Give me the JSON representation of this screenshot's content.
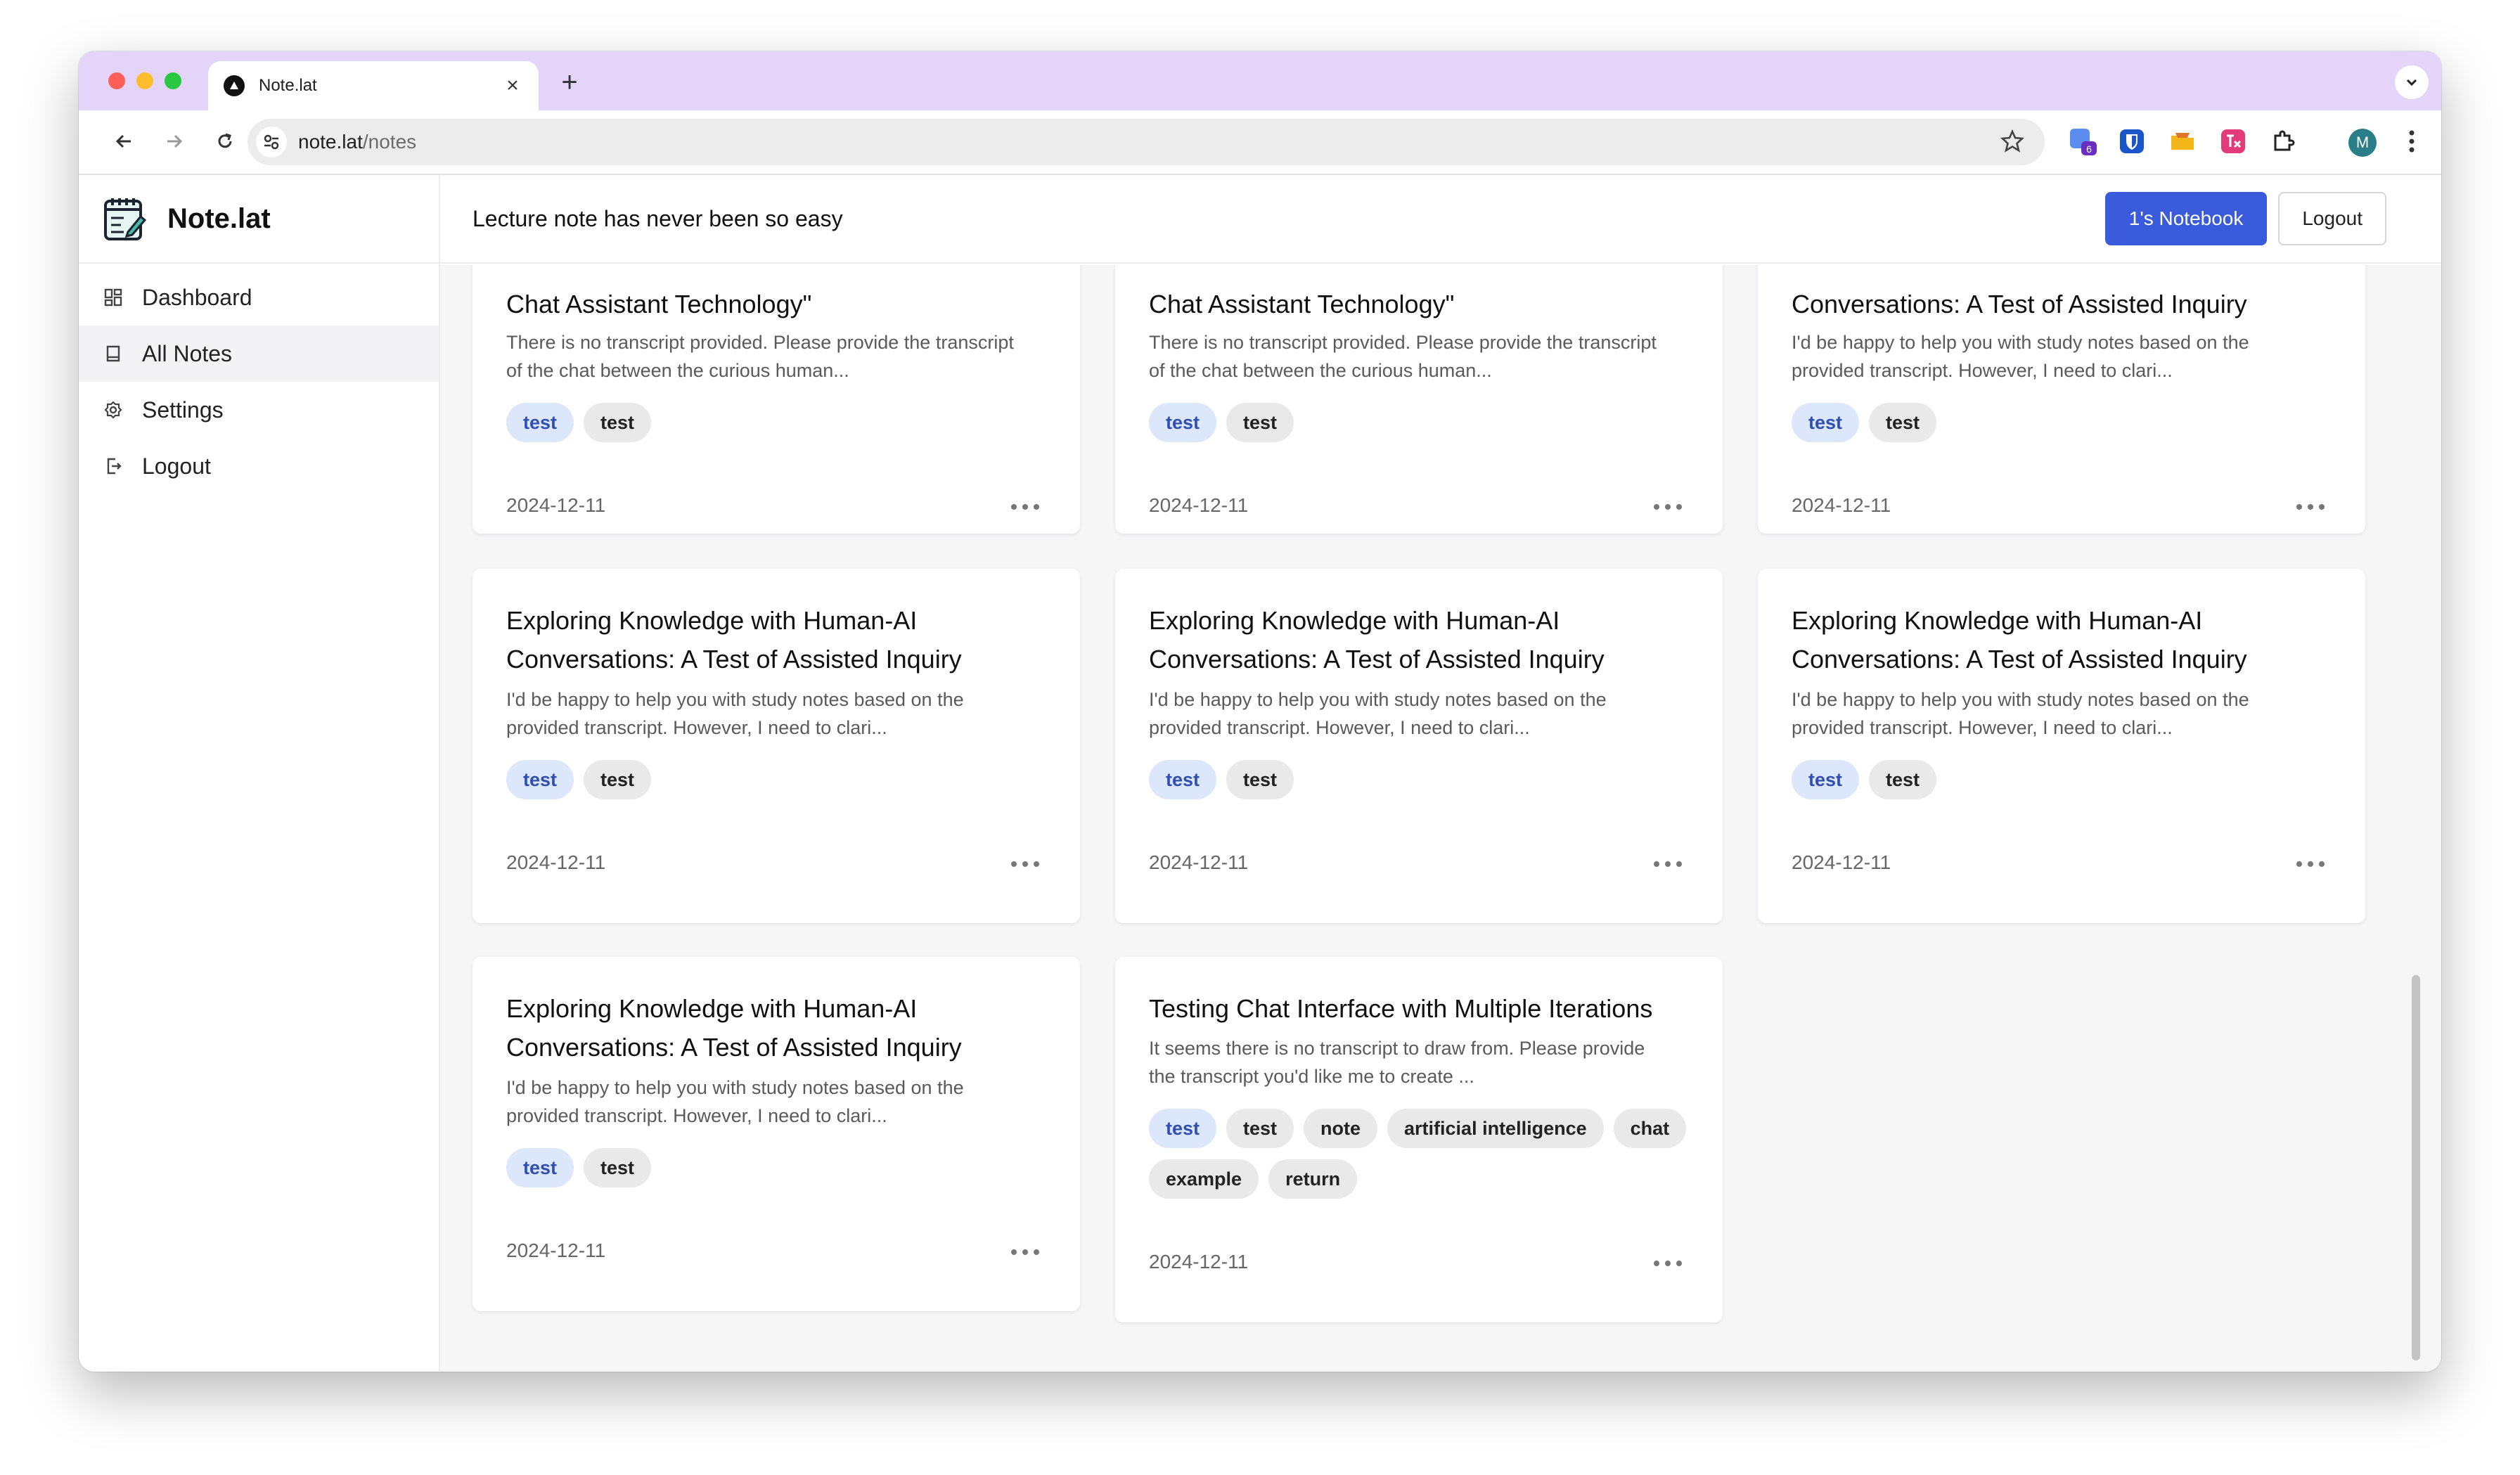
{
  "browser": {
    "tab_title": "Note.lat",
    "url_host": "note.lat",
    "url_path": "/notes",
    "extension_badge": "6",
    "profile_initial": "M"
  },
  "app": {
    "brand": "Note.lat",
    "tagline": "Lecture note has never been so easy",
    "notebook_button": "1's Notebook",
    "logout_button": "Logout"
  },
  "sidebar": {
    "items": [
      {
        "label": "Dashboard",
        "icon": "dashboard-icon"
      },
      {
        "label": "All Notes",
        "icon": "notebook-icon",
        "active": true
      },
      {
        "label": "Settings",
        "icon": "gear-icon"
      },
      {
        "label": "Logout",
        "icon": "logout-icon"
      }
    ]
  },
  "cards": [
    {
      "title": "Chat Assistant Technology\"",
      "desc_1": "There is no transcript provided. Please provide the transcript",
      "desc_2": "of the chat between the curious human...",
      "tags": [
        "test",
        "test"
      ],
      "date": "2024-12-11"
    },
    {
      "title": "Chat Assistant Technology\"",
      "desc_1": "There is no transcript provided. Please provide the transcript",
      "desc_2": "of the chat between the curious human...",
      "tags": [
        "test",
        "test"
      ],
      "date": "2024-12-11"
    },
    {
      "title": "Conversations: A Test of Assisted Inquiry",
      "desc_1": "I'd be happy to help you with study notes based on the",
      "desc_2": "provided transcript. However, I need to clari...",
      "tags": [
        "test",
        "test"
      ],
      "date": "2024-12-11"
    },
    {
      "title_1": "Exploring Knowledge with Human-AI",
      "title_2": "Conversations: A Test of Assisted Inquiry",
      "desc_1": "I'd be happy to help you with study notes based on the",
      "desc_2": "provided transcript. However, I need to clari...",
      "tags": [
        "test",
        "test"
      ],
      "date": "2024-12-11"
    },
    {
      "title_1": "Exploring Knowledge with Human-AI",
      "title_2": "Conversations: A Test of Assisted Inquiry",
      "desc_1": "I'd be happy to help you with study notes based on the",
      "desc_2": "provided transcript. However, I need to clari...",
      "tags": [
        "test",
        "test"
      ],
      "date": "2024-12-11"
    },
    {
      "title_1": "Exploring Knowledge with Human-AI",
      "title_2": "Conversations: A Test of Assisted Inquiry",
      "desc_1": "I'd be happy to help you with study notes based on the",
      "desc_2": "provided transcript. However, I need to clari...",
      "tags": [
        "test",
        "test"
      ],
      "date": "2024-12-11"
    },
    {
      "title_1": "Exploring Knowledge with Human-AI",
      "title_2": "Conversations: A Test of Assisted Inquiry",
      "desc_1": "I'd be happy to help you with study notes based on the",
      "desc_2": "provided transcript. However, I need to clari...",
      "tags": [
        "test",
        "test"
      ],
      "date": "2024-12-11"
    },
    {
      "title": "Testing Chat Interface with Multiple Iterations",
      "desc_1": "It seems there is no transcript to draw from. Please provide",
      "desc_2": "the transcript you'd like me to create ...",
      "tags": [
        "test",
        "test",
        "note",
        "artificial intelligence",
        "chat",
        "example",
        "return"
      ],
      "date": "2024-12-11"
    }
  ],
  "colors": {
    "tab_strip": "#e5d4f9",
    "primary_button": "#3a5bdb",
    "first_tag_bg": "#dde7fb",
    "first_tag_text": "#2f4fb3"
  }
}
